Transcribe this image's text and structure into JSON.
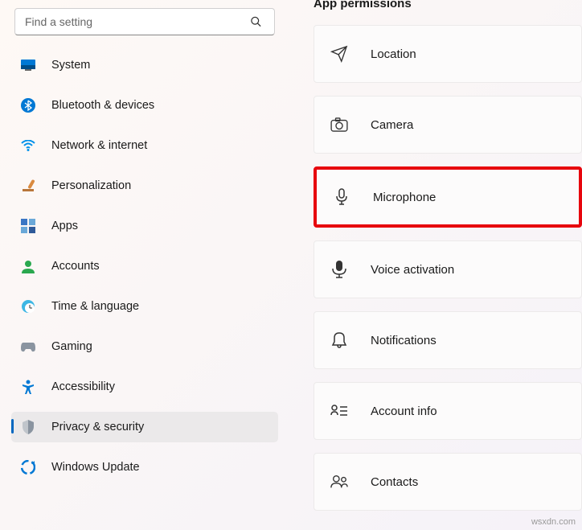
{
  "search": {
    "placeholder": "Find a setting"
  },
  "sidebar": {
    "items": [
      {
        "label": "System",
        "icon": "system"
      },
      {
        "label": "Bluetooth & devices",
        "icon": "bluetooth"
      },
      {
        "label": "Network & internet",
        "icon": "network"
      },
      {
        "label": "Personalization",
        "icon": "personalization"
      },
      {
        "label": "Apps",
        "icon": "apps"
      },
      {
        "label": "Accounts",
        "icon": "accounts"
      },
      {
        "label": "Time & language",
        "icon": "time"
      },
      {
        "label": "Gaming",
        "icon": "gaming"
      },
      {
        "label": "Accessibility",
        "icon": "accessibility"
      },
      {
        "label": "Privacy & security",
        "icon": "privacy"
      },
      {
        "label": "Windows Update",
        "icon": "update"
      }
    ],
    "selected_index": 9
  },
  "main": {
    "section_title": "App permissions",
    "permissions": [
      {
        "label": "Location",
        "icon": "location"
      },
      {
        "label": "Camera",
        "icon": "camera"
      },
      {
        "label": "Microphone",
        "icon": "microphone"
      },
      {
        "label": "Voice activation",
        "icon": "voice"
      },
      {
        "label": "Notifications",
        "icon": "notifications"
      },
      {
        "label": "Account info",
        "icon": "accountinfo"
      },
      {
        "label": "Contacts",
        "icon": "contacts"
      }
    ],
    "highlighted_index": 2
  },
  "watermark": "wsxdn.com"
}
